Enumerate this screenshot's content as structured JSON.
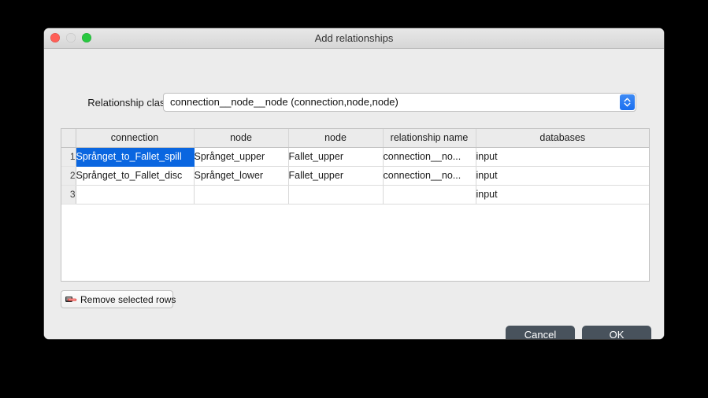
{
  "window": {
    "title": "Add relationships",
    "traffic_lights": [
      "close-light",
      "minimize-light",
      "zoom-light"
    ]
  },
  "form": {
    "relationship_class_label": "Relationship class",
    "relationship_class_value": "connection__node__node (connection,node,node)",
    "stepper_icon": "up-down-chevron-icon"
  },
  "table": {
    "columns": [
      "connection",
      "node",
      "node",
      "relationship name",
      "databases"
    ],
    "rows": [
      {
        "number": "1",
        "cells": [
          "Språnget_to_Fallet_spill",
          "Språnget_upper",
          "Fallet_upper",
          "connection__no...",
          "input"
        ],
        "selected_cell_index": 0
      },
      {
        "number": "2",
        "cells": [
          "Språnget_to_Fallet_disc",
          "Språnget_lower",
          "Fallet_upper",
          "connection__no...",
          "input"
        ],
        "selected_cell_index": -1
      },
      {
        "number": "3",
        "cells": [
          "",
          "",
          "",
          "",
          "input"
        ],
        "selected_cell_index": -1
      }
    ]
  },
  "actions": {
    "remove_rows_label": "Remove selected rows",
    "remove_rows_icon": "remove-row-icon",
    "cancel_label": "Cancel",
    "ok_label": "OK"
  },
  "colors": {
    "selection_blue": "#0a66e0",
    "button_dark": "#48525c",
    "stepper_blue": "#1a6ff0",
    "dialog_background": "#ececec",
    "desktop_background": "#000000"
  }
}
